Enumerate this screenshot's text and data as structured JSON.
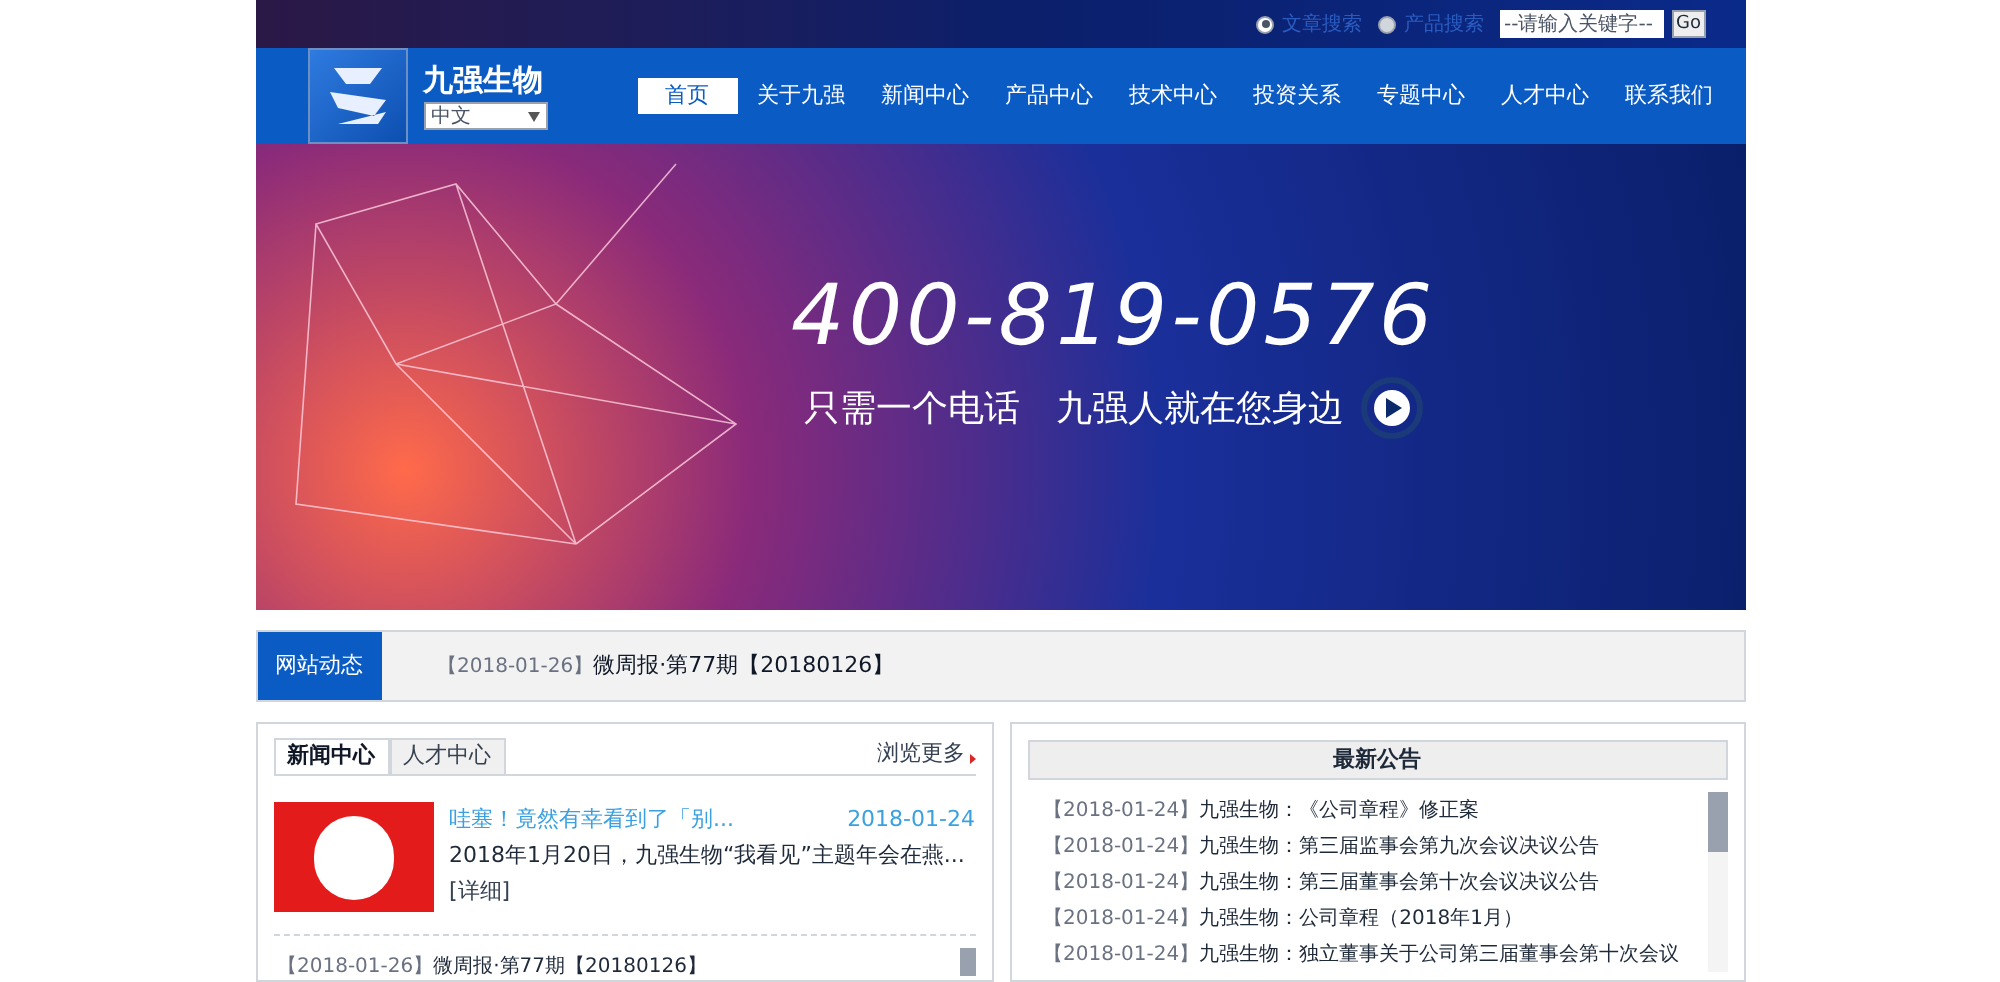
{
  "search": {
    "options": [
      {
        "label": "文章搜索",
        "selected": true
      },
      {
        "label": "产品搜索",
        "selected": false
      }
    ],
    "placeholder": "--请输入关键字--",
    "button": "Go"
  },
  "brand": {
    "name": "九强生物",
    "language": "中文"
  },
  "nav": [
    {
      "label": "首页",
      "selected": true
    },
    {
      "label": "关于九强",
      "selected": false
    },
    {
      "label": "新闻中心",
      "selected": false
    },
    {
      "label": "产品中心",
      "selected": false
    },
    {
      "label": "技术中心",
      "selected": false
    },
    {
      "label": "投资关系",
      "selected": false
    },
    {
      "label": "专题中心",
      "selected": false
    },
    {
      "label": "人才中心",
      "selected": false
    },
    {
      "label": "联系我们",
      "selected": false
    }
  ],
  "banner": {
    "phone": "400-819-0576",
    "slogan": "只需一个电话　九强人就在您身边"
  },
  "ticker": {
    "label": "网站动态",
    "date": "【2018-01-26】",
    "title": "微周报·第77期【20180126】"
  },
  "news": {
    "tabs": [
      {
        "label": "新闻中心",
        "selected": true
      },
      {
        "label": "人才中心",
        "selected": false
      }
    ],
    "more": "浏览更多",
    "featured": {
      "title": "哇塞！竟然有幸看到了「别...",
      "date": "2018-01-24",
      "summary": "2018年1月20日，九强生物“我看见”主题年会在燕...",
      "link": "[详细]"
    },
    "items": [
      {
        "date": "【2018-01-26】",
        "title": "微周报·第77期【20180126】"
      }
    ]
  },
  "notices": {
    "title": "最新公告",
    "items": [
      {
        "date": "【2018-01-24】",
        "title": "九强生物：《公司章程》修正案"
      },
      {
        "date": "【2018-01-24】",
        "title": "九强生物：第三届监事会第九次会议决议公告"
      },
      {
        "date": "【2018-01-24】",
        "title": "九强生物：第三届董事会第十次会议决议公告"
      },
      {
        "date": "【2018-01-24】",
        "title": "九强生物：公司章程（2018年1月）"
      },
      {
        "date": "【2018-01-24】",
        "title": "九强生物：独立董事关于公司第三届董事会第十次会议"
      }
    ]
  }
}
